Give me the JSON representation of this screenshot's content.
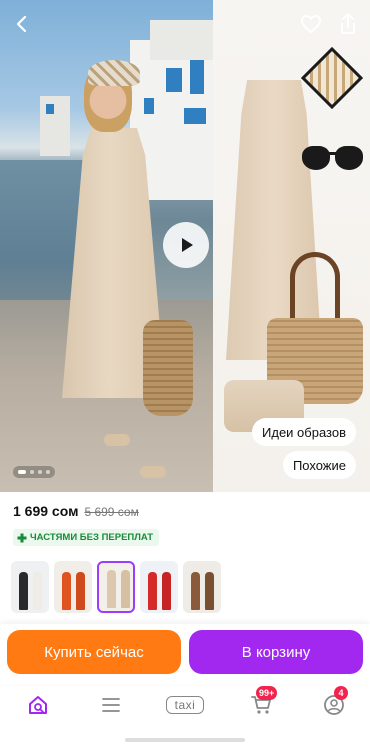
{
  "product": {
    "price": "1 699 сом",
    "old_price": "5 699 сом",
    "installments_label": "ЧАСТЯМИ БЕЗ ПЕРЕПЛАТ",
    "looks_label": "Идеи образов",
    "similar_label": "Похожие"
  },
  "gallery": {
    "dot_count": 4,
    "active_dot": 0
  },
  "variants": [
    {
      "colors": [
        "#2a2a2a",
        "#f0ece5"
      ],
      "bg": "#eef0f2"
    },
    {
      "colors": [
        "#e0551f",
        "#cf4a1c"
      ],
      "bg": "#f1ede8"
    },
    {
      "colors": [
        "#dcc8ae",
        "#d6c0a3"
      ],
      "bg": "#f3efe9",
      "selected": true
    },
    {
      "colors": [
        "#d42a2a",
        "#c62424"
      ],
      "bg": "#eef1f5"
    },
    {
      "colors": [
        "#8a5a3a",
        "#7a4e31"
      ],
      "bg": "#efebe6"
    }
  ],
  "actions": {
    "buy_now": "Купить сейчас",
    "add_to_cart": "В корзину"
  },
  "nav": {
    "taxi_label": "taxi",
    "cart_badge": "99+",
    "profile_badge": "4"
  },
  "colors": {
    "buy": "#ff7a12",
    "cart": "#a228f0",
    "accent": "#9b3cff",
    "badge": "#f2234c",
    "installments": "#1a8a3a"
  },
  "icons": [
    "back-arrow-icon",
    "heart-icon",
    "share-icon",
    "play-icon",
    "plus-icon",
    "home-search-icon",
    "menu-icon",
    "cart-icon",
    "profile-icon"
  ]
}
